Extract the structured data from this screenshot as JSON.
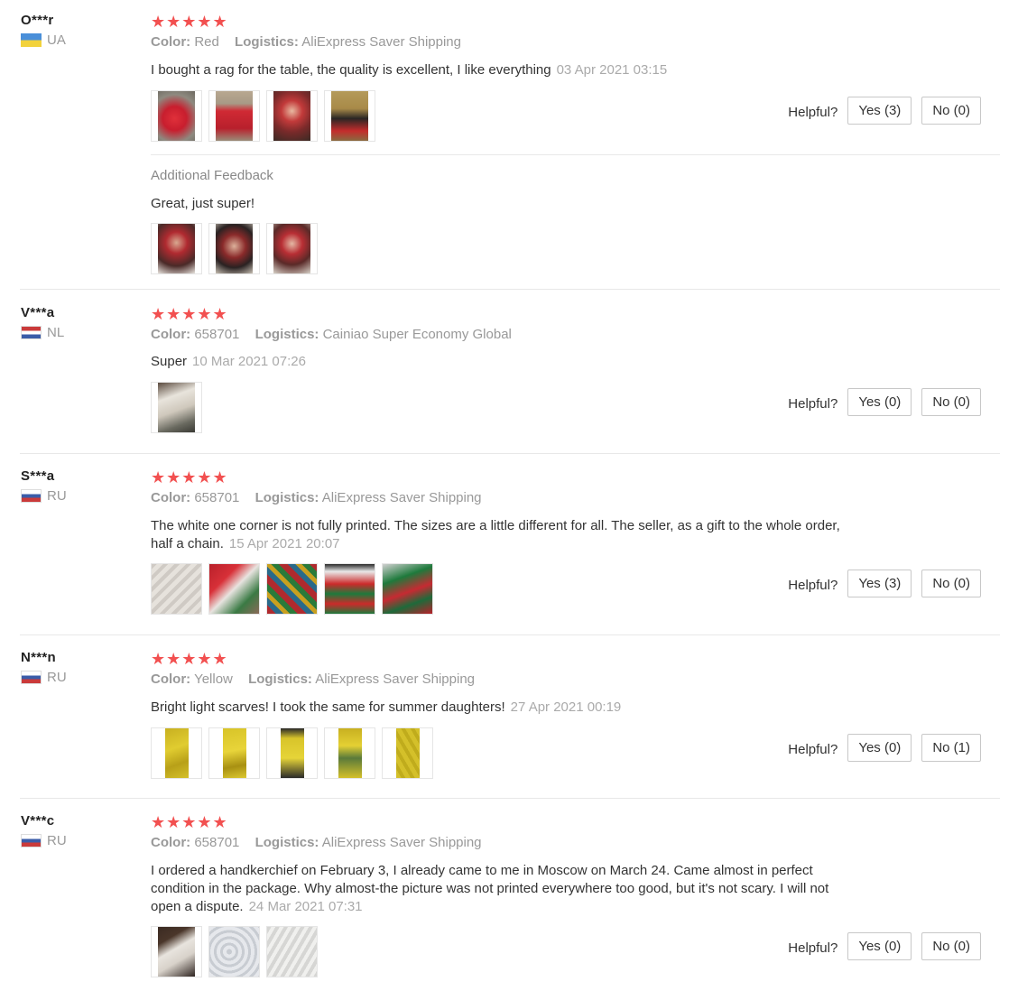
{
  "labels": {
    "color": "Color:",
    "logistics": "Logistics:",
    "helpful": "Helpful?",
    "additional_feedback": "Additional Feedback"
  },
  "colors": {
    "star": "#f25050",
    "muted": "#999999"
  },
  "reviews": [
    {
      "user": "O***r",
      "country": "UA",
      "stars": "★★★★★",
      "color": "Red",
      "logistics": "AliExpress Saver Shipping",
      "text": "I bought a rag for the table, the quality is excellent, I like everything",
      "date": "03 Apr 2021 03:15",
      "yes": "Yes (3)",
      "no": "No (0)",
      "photo_count": 4,
      "additional": {
        "text": "Great, just super!",
        "photo_count": 3
      }
    },
    {
      "user": "V***a",
      "country": "NL",
      "stars": "★★★★★",
      "color": "658701",
      "logistics": "Cainiao Super Economy Global",
      "text": "Super",
      "date": "10 Mar 2021 07:26",
      "yes": "Yes (0)",
      "no": "No (0)",
      "photo_count": 1
    },
    {
      "user": "S***a",
      "country": "RU",
      "stars": "★★★★★",
      "color": "658701",
      "logistics": "AliExpress Saver Shipping",
      "text_line1": "The white one corner is not fully printed. The sizes are a little different for all. The seller, as a gift to the whole order,",
      "text_line2": "half a chain.",
      "date": "15 Apr 2021 20:07",
      "yes": "Yes (3)",
      "no": "No (0)",
      "photo_count": 5
    },
    {
      "user": "N***n",
      "country": "RU",
      "stars": "★★★★★",
      "color": "Yellow",
      "logistics": "AliExpress Saver Shipping",
      "text": "Bright light scarves! I took the same for summer daughters!",
      "date": "27 Apr 2021 00:19",
      "yes": "Yes (0)",
      "no": "No (1)",
      "photo_count": 5
    },
    {
      "user": "V***c",
      "country": "RU",
      "stars": "★★★★★",
      "color": "658701",
      "logistics": "AliExpress Saver Shipping",
      "text_line1": "I ordered a handkerchief on February 3, I already came to me in Moscow on March 24. Came almost in perfect",
      "text_line2": "condition in the package. Why almost-the picture was not printed everywhere too good, but it's not scary. I will not",
      "text_line3": "open a dispute.",
      "date": "24 Mar 2021 07:31",
      "yes": "Yes (0)",
      "no": "No (0)",
      "photo_count": 3
    }
  ]
}
